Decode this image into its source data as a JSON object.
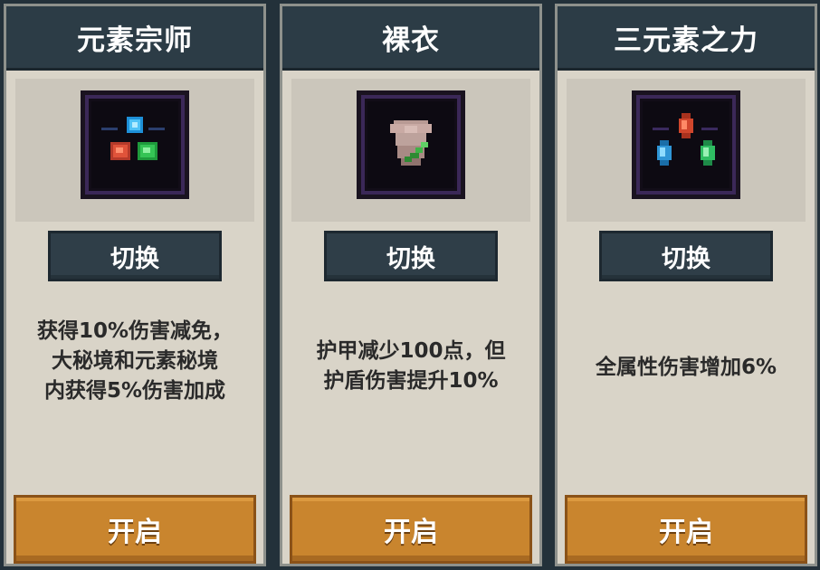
{
  "cards": [
    {
      "title": "元素宗师",
      "icon": "three-elements-orb-icon",
      "switch_label": "切换",
      "description": [
        "获得10%伤害减免，",
        "大秘境和元素秘境",
        "内获得5%伤害加成"
      ],
      "open_label": "开启"
    },
    {
      "title": "裸衣",
      "icon": "bare-armor-icon",
      "switch_label": "切换",
      "description": [
        "护甲减少100点，但",
        "护盾伤害提升10%"
      ],
      "open_label": "开启"
    },
    {
      "title": "三元素之力",
      "icon": "three-crystals-icon",
      "switch_label": "切换",
      "description": [
        "全属性伤害增加6%"
      ],
      "open_label": "开启"
    }
  ],
  "colors": {
    "header": "#2c3c46",
    "card_bg": "#d9d4c8",
    "open_button": "#c9852e",
    "switch_button": "#2f3e48"
  }
}
